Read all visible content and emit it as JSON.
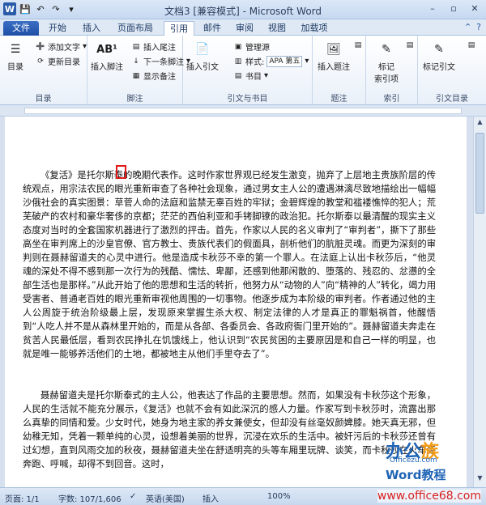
{
  "window": {
    "title": "文档3 [兼容模式] - Microsoft Word",
    "qat": [
      "W",
      "💾",
      "↶",
      "↷",
      "▾"
    ],
    "controls": [
      "–",
      "▫",
      "✕"
    ]
  },
  "tabs": [
    "文件",
    "开始",
    "插入",
    "页面布局",
    "引用",
    "邮件",
    "审阅",
    "视图",
    "加载项"
  ],
  "ribbon": {
    "toc": {
      "label": "目录",
      "add_text": "添加文字",
      "update": "更新目录",
      "group": "目录"
    },
    "footnote": {
      "insert": "插入脚注",
      "insert_endnote": "插入尾注",
      "next": "下一条脚注",
      "show": "显示备注",
      "group": "脚注",
      "icon_text": "AB¹"
    },
    "citation": {
      "insert": "插入引文",
      "manage": "管理源",
      "style_label": "样式:",
      "style_value": "APA 第五",
      "bibliography": "书目",
      "group": "引文与书目"
    },
    "caption": {
      "insert": "插入题注",
      "group": "题注"
    },
    "index": {
      "mark": "标记",
      "mark2": "索引项",
      "group": "索引"
    },
    "toa": {
      "mark": "标记引文",
      "group": "引文目录"
    }
  },
  "document": {
    "paragraphs": [
      "《复活》是托尔斯泰的晚期代表作。这时作家世界观已经发生激变，抛弃了上层地主贵族阶层的传统观点，用宗法农民的眼光重新审查了各种社会现象，通过男女主人公的遭遇淋漓尽致地描绘出一幅幅沙俄社会的真实图景：草菅人命的法庭和监禁无辜百姓的牢狱；金碧辉煌的教堂和褴褛憔悴的犯人；荒芜破产的农村和豪华奢侈的京都；茫茫的西伯利亚和手铐脚镣的政治犯。托尔斯泰以最清醒的现实主义态度对当时的全套国家机器进行了激烈的抨击。首先，作家以人民的名义审判了“审判者”，撕下了那些高坐在审判席上的沙皇官僚、官方教士、贵族代表们的假面具，剖析他们的肮脏灵魂。而更为深刻的审判则在聂赫留道夫的心灵中进行。他是造成卡秋莎不幸的第一个罪人。在法庭上认出卡秋莎后，“他灵魂的深处不得不感到那一次行为的残酷、懦怯、卑鄙，还感到他那闲散的、堕落的、残忍的、忿懑的全部生活也是那样。”从此开始了他的思想和生活的转折，他努力从“动物的人”向“精神的人”转化，竭力用受害者、普通老百姓的眼光重新审视他周围的一切事物。他逐步成为本阶级的审判者。作者通过他的主人公周旋于统治阶级最上层，发现原来掌握生杀大权、制定法律的人才是真正的罪魁祸首，他醒悟到“人吃人并不是从森林里开始的，而是从各部、各委员会、各政府衙门里开始的”。聂赫留道夫奔走在贫苦人民最低层，看到农民挣扎在饥饿线上，他认识到“农民贫困的主要原因是和自己一样的明显，也就是唯一能够养活他们的土地，都被地主从他们手里夺去了”。",
      "聂赫留道夫是托尔斯泰式的主人公，他表达了作品的主要思想。然而，如果没有卡秋莎这个形象，人民的生活就不能充分展示，《复活》也就不会有如此深沉的感人力量。作家写到卡秋莎时，流露出那么真挚的同情和爱。少女时代，她身为地主家的养女兼使女，但却没有丝毫奴颜婢膝。她天真无邪，但幼稚无知，凭着一颗单纯的心灵，设想着美丽的世界，沉浸在欢乐的生活中。被奸污后的卡秋莎还曾有过幻想，直到风雨交加的秋夜，聂赫留道夫坐在舒适明亮的头等车厢里玩牌、谈笑，而卡秋莎在火车旁奔跑、呼喊，却得不到回音。这时，"
    ]
  },
  "watermark": {
    "logo_main": "办公",
    "logo_accent": "族",
    "logo_sub": "Officezu.com",
    "logo_word": "Word教程",
    "site": "www.office68.com"
  },
  "status": {
    "page": "页面: 1/1",
    "words": "字数: 107/1,606",
    "lang": "英语(美国)",
    "mode": "插入",
    "zoom": "100%"
  },
  "colors": {
    "accent": "#2a5ba8",
    "file_tab": "#2a5ba8",
    "highlight": "#e0191b"
  }
}
